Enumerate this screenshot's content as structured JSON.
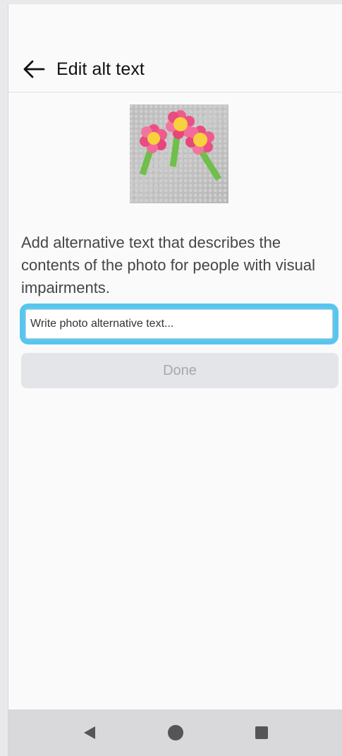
{
  "header": {
    "title": "Edit alt text"
  },
  "main": {
    "description": "Add alternative text that describes the contents of the photo for people with visual impairments.",
    "alt_input": {
      "placeholder": "Write photo alternative text...",
      "value": ""
    },
    "done_label": "Done"
  },
  "colors": {
    "highlight": "#57c6ef",
    "pointer": "#c23fd0",
    "done_disabled_bg": "#e4e5e8"
  },
  "icons": {
    "back": "back-arrow-icon",
    "nav_back": "triangle-back-icon",
    "nav_home": "circle-home-icon",
    "nav_recents": "square-recents-icon"
  }
}
